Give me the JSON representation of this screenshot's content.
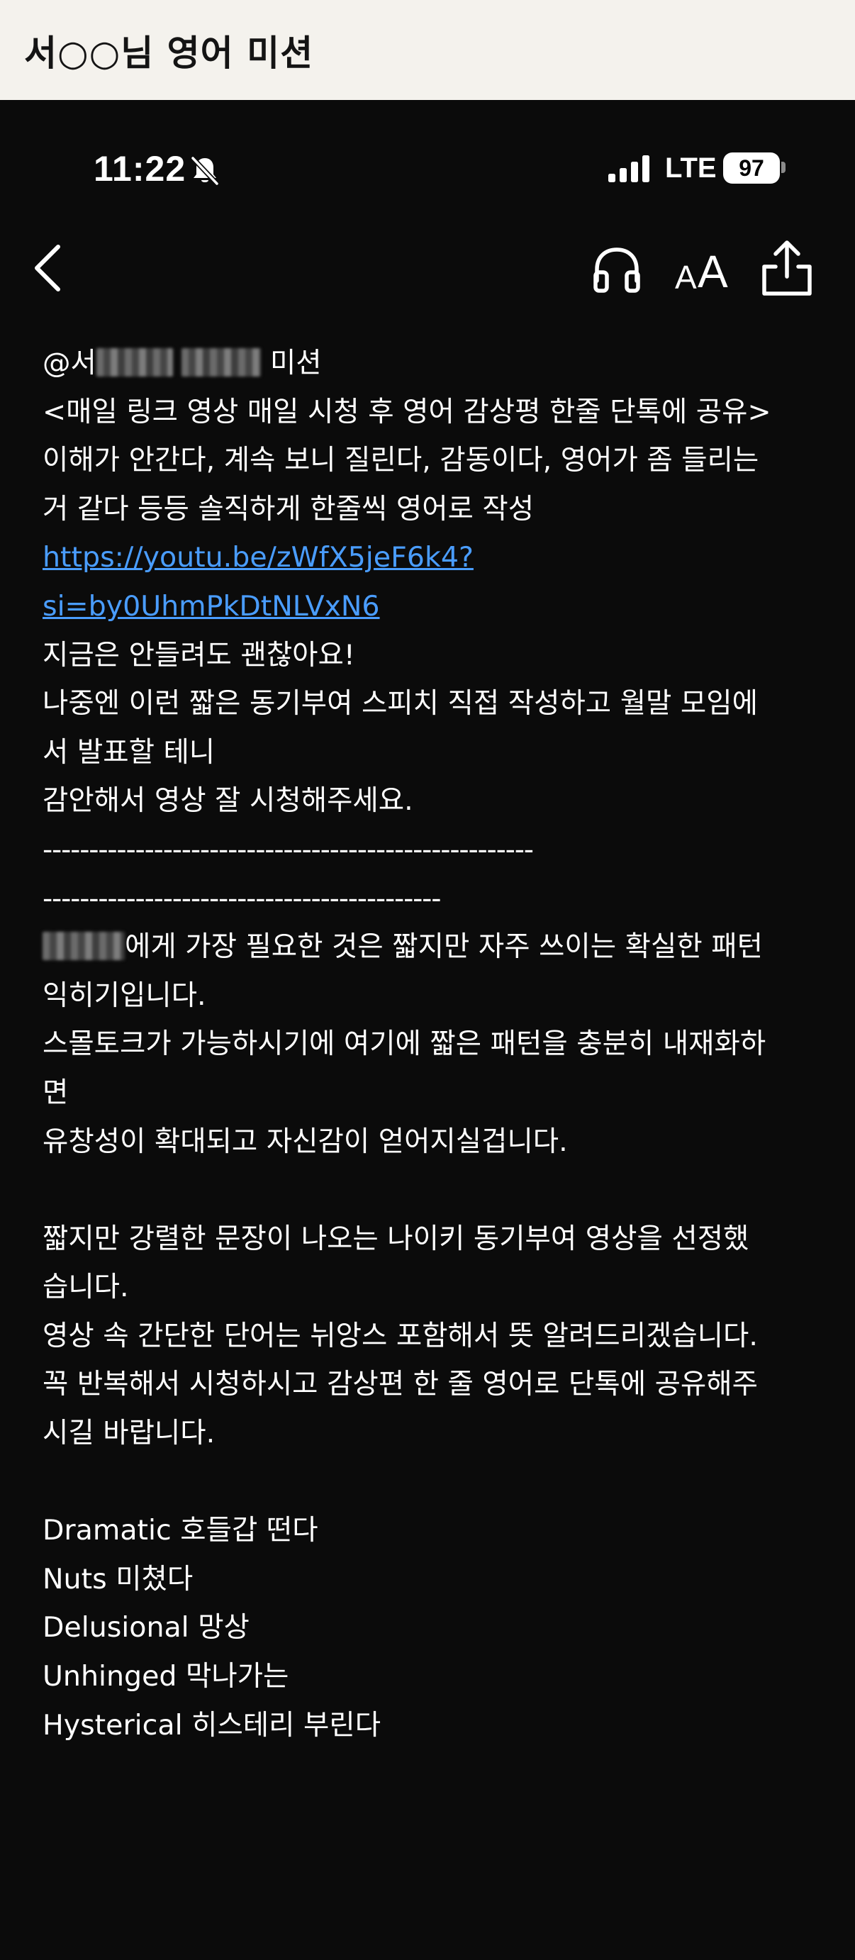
{
  "banner": {
    "title": "서○○님 영어 미션"
  },
  "status_bar": {
    "time": "11:22",
    "network": "LTE",
    "battery": "97"
  },
  "icons": {
    "back": "chevron-left-icon",
    "headphones": "headphones-icon",
    "text_size": "text-size-icon",
    "share": "share-icon",
    "bell": "bell-slash-icon",
    "signal": "signal-icon"
  },
  "text_size_label": {
    "small": "A",
    "large": "A"
  },
  "message": {
    "mention_prefix": "@서",
    "mention_suffix": "미션",
    "line_1": "<매일 링크 영상 매일 시청 후 영어 감상평 한줄 단톡에 공유>",
    "line_2": "이해가 안간다, 계속 보니 질린다, 감동이다, 영어가 좀 들리는",
    "line_3": "거 같다 등등 솔직하게 한줄씩 영어로 작성",
    "link_part_1": "https://youtu.be/zWfX5jeF6k4?",
    "link_part_2": "si=by0UhmPkDtNLVxN6",
    "line_4": "지금은 안들려도 괜찮아요!",
    "line_5": "나중엔 이런 짧은 동기부여 스피치 직접 작성하고 월말 모임에",
    "line_6": "서 발표할 테니",
    "line_7": "감안해서 영상 잘 시청해주세요.",
    "divider_1": "-----------------------------------------------------",
    "divider_2": "-------------------------------------------",
    "line_8_suffix": "에게 가장 필요한 것은 짧지만 자주 쓰이는 확실한 패턴",
    "line_9": "익히기입니다.",
    "line_10": "스몰토크가 가능하시기에 여기에 짧은 패턴을 충분히 내재화하",
    "line_11": "면",
    "line_12": "유창성이 확대되고 자신감이 얻어지실겁니다.",
    "line_13": "짧지만 강렬한 문장이 나오는 나이키 동기부여 영상을 선정했",
    "line_14": "습니다.",
    "line_15": "영상 속 간단한 단어는 뉘앙스 포함해서 뜻 알려드리겠습니다.",
    "line_16": "꼭 반복해서 시청하시고 감상편 한 줄 영어로 단톡에 공유해주",
    "line_17": "시길 바랍니다.",
    "vocab": [
      "Dramatic 호들갑 떤다",
      "Nuts 미쳤다",
      "Delusional 망상",
      "Unhinged 막나가는",
      "Hysterical 히스테리 부린다"
    ]
  }
}
